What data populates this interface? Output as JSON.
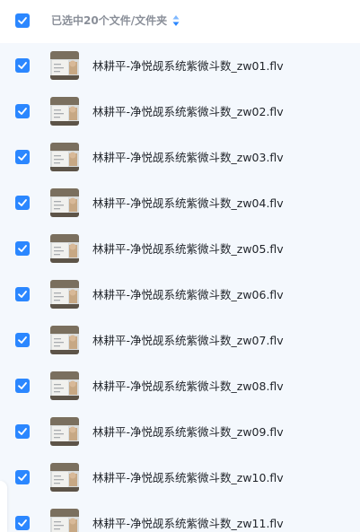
{
  "header": {
    "selection_label": "已选中20个文件/文件夹"
  },
  "icons": {
    "checkbox": "checkbox-checked-icon",
    "sort": "sort-icon",
    "thumbnail": "video-thumbnail-icon"
  },
  "colors": {
    "accent": "#2b87ff",
    "list_background": "#f4f8fd",
    "header_text": "#8a8f99",
    "file_text": "#1f2329"
  },
  "files": [
    {
      "name": "林耕平-净悦觇系统紫微斗数_zw01.flv",
      "checked": true
    },
    {
      "name": "林耕平-净悦觇系统紫微斗数_zw02.flv",
      "checked": true
    },
    {
      "name": "林耕平-净悦觇系统紫微斗数_zw03.flv",
      "checked": true
    },
    {
      "name": "林耕平-净悦觇系统紫微斗数_zw04.flv",
      "checked": true
    },
    {
      "name": "林耕平-净悦觇系统紫微斗数_zw05.flv",
      "checked": true
    },
    {
      "name": "林耕平-净悦觇系统紫微斗数_zw06.flv",
      "checked": true
    },
    {
      "name": "林耕平-净悦觇系统紫微斗数_zw07.flv",
      "checked": true
    },
    {
      "name": "林耕平-净悦觇系统紫微斗数_zw08.flv",
      "checked": true
    },
    {
      "name": "林耕平-净悦觇系统紫微斗数_zw09.flv",
      "checked": true
    },
    {
      "name": "林耕平-净悦觇系统紫微斗数_zw10.flv",
      "checked": true
    },
    {
      "name": "林耕平-净悦觇系统紫微斗数_zw11.flv",
      "checked": true
    }
  ]
}
